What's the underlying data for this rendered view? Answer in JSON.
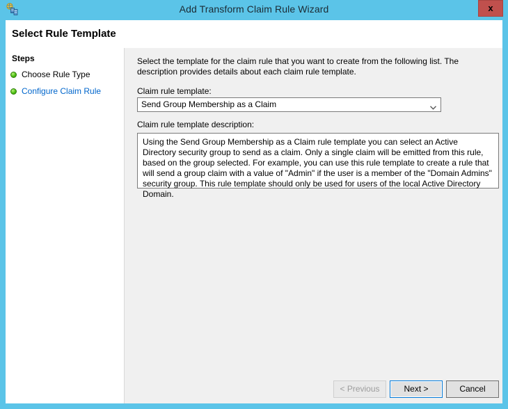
{
  "window": {
    "title": "Add Transform Claim Rule Wizard",
    "icon": "adfs-wizard-icon",
    "close_label": "x"
  },
  "header": {
    "title": "Select Rule Template"
  },
  "sidebar": {
    "heading": "Steps",
    "items": [
      {
        "label": "Choose Rule Type",
        "state": "done"
      },
      {
        "label": "Configure Claim Rule",
        "state": "current"
      }
    ]
  },
  "main": {
    "intro": "Select the template for the claim rule that you want to create from the following list. The description provides details about each claim rule template.",
    "template_label": "Claim rule template:",
    "template_value": "Send Group Membership as a Claim",
    "description_label": "Claim rule template description:",
    "description_text": "Using the Send Group Membership as a Claim rule template you can select an Active Directory security group to send as a claim. Only a single claim will be emitted from this rule, based on the group selected. For example, you can use this rule template to create a rule that will send a group claim with a value of \"Admin\" if the user is a member of the \"Domain Admins\" security group.  This rule template should only be used for users of the local Active Directory Domain."
  },
  "footer": {
    "previous_label": "< Previous",
    "next_label": "Next >",
    "cancel_label": "Cancel"
  },
  "colors": {
    "frame_blue": "#5bc4e8",
    "close_red": "#c0504d",
    "current_step_blue": "#0066cc",
    "focus_blue": "#0078d7",
    "panel_gray": "#f0f0f0"
  }
}
